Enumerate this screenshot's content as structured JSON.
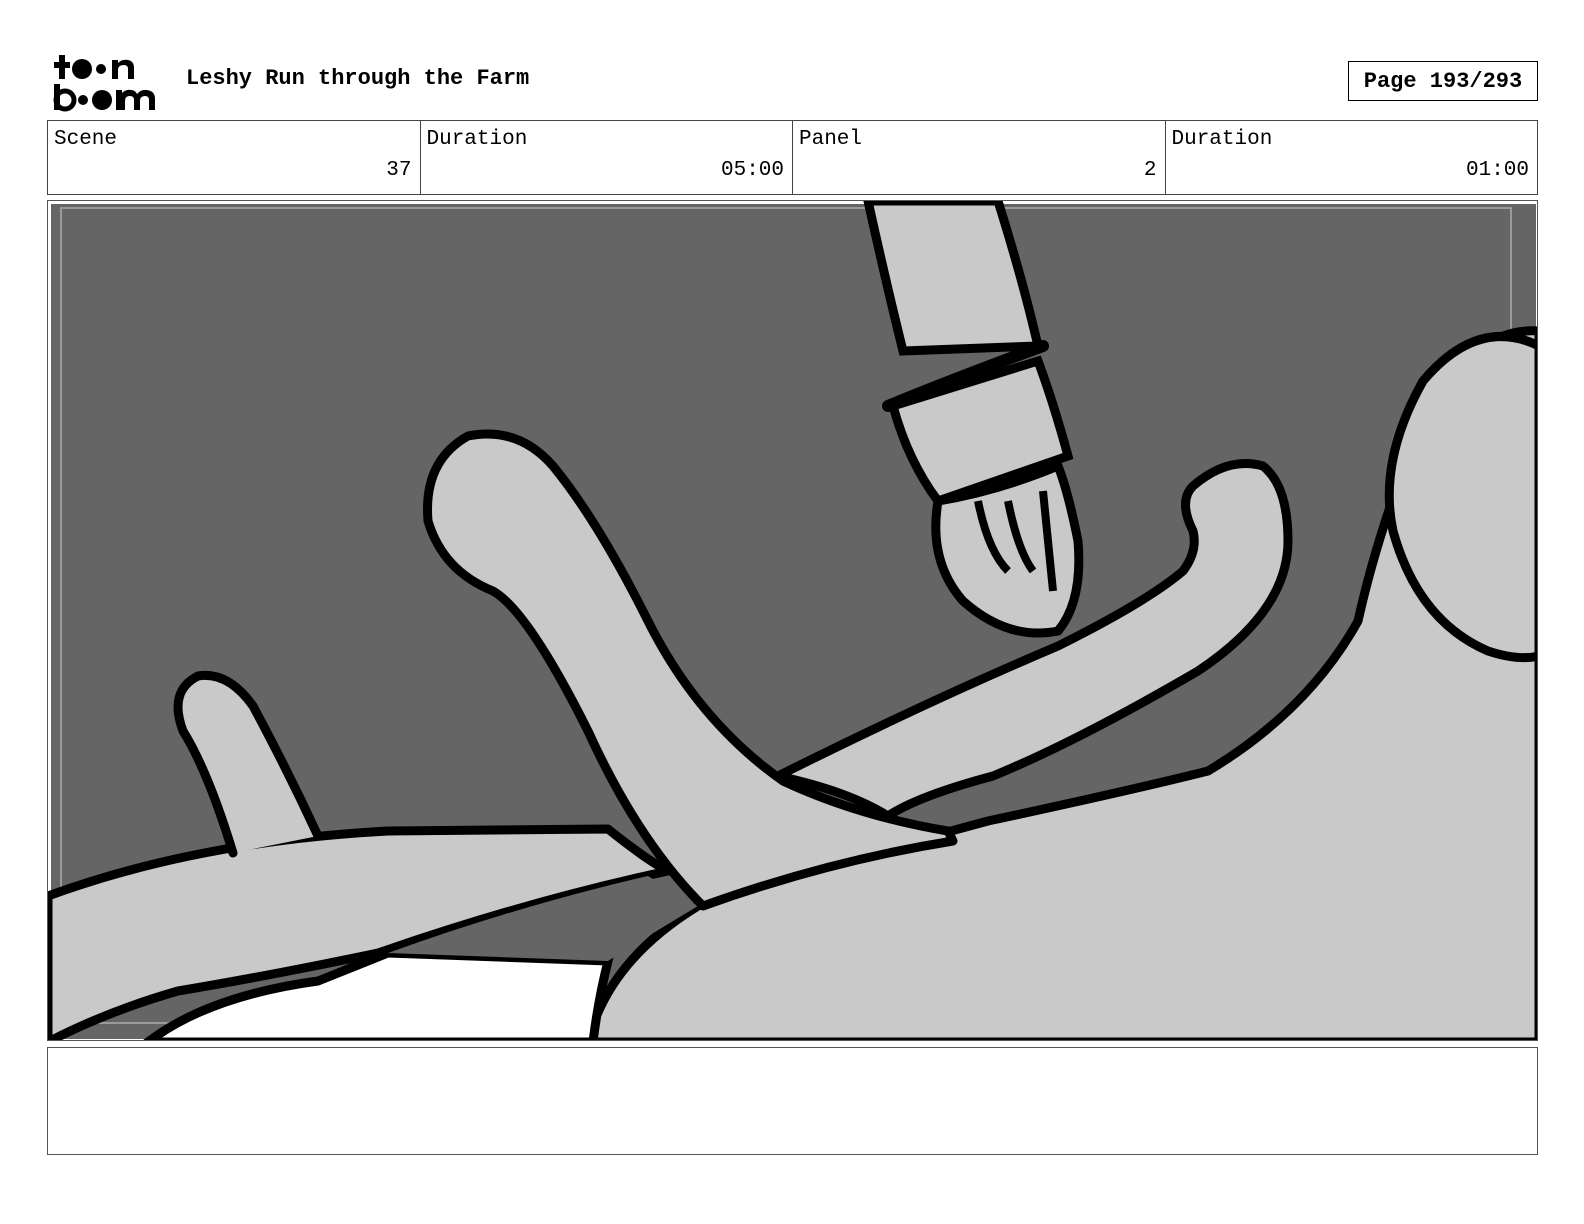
{
  "header": {
    "logo_text_line1": "toon",
    "logo_text_line2": "boom",
    "project_title": "Leshy Run through the Farm",
    "page_label": "Page 193/293"
  },
  "info": {
    "scene_label": "Scene",
    "scene_value": "37",
    "scene_duration_label": "Duration",
    "scene_duration_value": "05:00",
    "panel_label": "Panel",
    "panel_value": "2",
    "panel_duration_label": "Duration",
    "panel_duration_value": "01:00"
  },
  "panel": {
    "background_color": "#656565",
    "fill_color": "#c9c9c9",
    "line_color": "#000000"
  },
  "notes": {
    "text": ""
  }
}
